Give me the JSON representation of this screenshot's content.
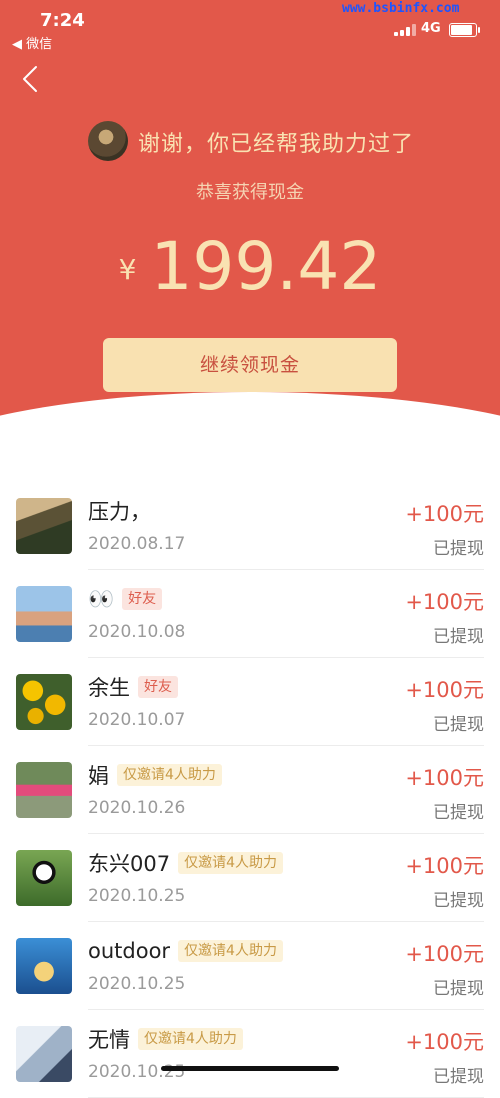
{
  "status_bar": {
    "time": "7:24",
    "back_app": "◀ 微信",
    "network": "4G",
    "watermark": "www.bsbinfx.com"
  },
  "colors": {
    "hero_red": "#e2584a",
    "gold_text": "#f9e2b2",
    "button_bg": "#f9e1b1",
    "amount_red": "#e2584a"
  },
  "hero": {
    "helper_message": "谢谢，你已经帮我助力过了",
    "congrats": "恭喜获得现金",
    "currency": "¥",
    "amount": "199.42",
    "cta_label": "继续领现金"
  },
  "list": [
    {
      "name": "压力，",
      "tag": "",
      "tag_type": "",
      "date": "2020.08.17",
      "amount": "+100元",
      "status": "已提现",
      "avatar": "photo-man"
    },
    {
      "name": "👀",
      "tag": "好友",
      "tag_type": "friend",
      "date": "2020.10.08",
      "amount": "+100元",
      "status": "已提现",
      "avatar": "photo-child-flag"
    },
    {
      "name": "余生",
      "tag": "好友",
      "tag_type": "friend",
      "date": "2020.10.07",
      "amount": "+100元",
      "status": "已提现",
      "avatar": "photo-flowers"
    },
    {
      "name": "娟",
      "tag": "仅邀请4人助力",
      "tag_type": "limited",
      "date": "2020.10.26",
      "amount": "+100元",
      "status": "已提现",
      "avatar": "photo-kids"
    },
    {
      "name": "东兴007",
      "tag": "仅邀请4人助力",
      "tag_type": "limited",
      "date": "2020.10.25",
      "amount": "+100元",
      "status": "已提现",
      "avatar": "photo-panda"
    },
    {
      "name": "outdoor",
      "tag": "仅邀请4人助力",
      "tag_type": "limited",
      "date": "2020.10.25",
      "amount": "+100元",
      "status": "已提现",
      "avatar": "cartoon-girl"
    },
    {
      "name": "无情",
      "tag": "仅邀请4人助力",
      "tag_type": "limited",
      "date": "2020.10.25",
      "amount": "+100元",
      "status": "已提现",
      "avatar": "illustration"
    }
  ]
}
